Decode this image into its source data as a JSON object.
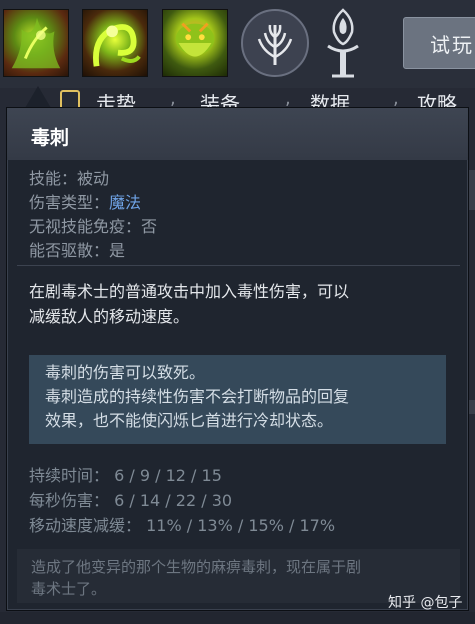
{
  "abilities": [
    {
      "name": "ability-1-icon",
      "colors": [
        "#b7e32a",
        "#5b2a10"
      ]
    },
    {
      "name": "ability-2-icon",
      "colors": [
        "#e8ff3a",
        "#4a2a0c"
      ]
    },
    {
      "name": "ability-3-icon",
      "colors": [
        "#ff9b3a",
        "#3f5a10"
      ]
    }
  ],
  "header": {
    "try_button": "试玩"
  },
  "tabs": [
    {
      "label": "走势"
    },
    {
      "label": "装备"
    },
    {
      "label": "数据"
    },
    {
      "label": "攻略"
    }
  ],
  "tooltip": {
    "title": "毒刺",
    "stats": [
      {
        "label": "技能：",
        "value": "被动"
      },
      {
        "label": "伤害类型：",
        "value": "魔法"
      },
      {
        "label": "无视技能免疫：",
        "value": "否"
      },
      {
        "label": "能否驱散：",
        "value": "是"
      }
    ],
    "description_lines": [
      "在剧毒术士的普通攻击中加入毒性伤害，可以",
      "减缓敌人的移动速度。"
    ],
    "note_lines": [
      "毒刺的伤害可以致死。",
      "毒刺造成的持续性伤害不会打断物品的回复",
      "效果，也不能使闪烁匕首进行冷却状态。"
    ],
    "attributes": [
      {
        "label": "持续时间：",
        "value": "6 / 9 / 12 / 15"
      },
      {
        "label": "每秒伤害：",
        "value": "6 / 14 / 22 / 30"
      },
      {
        "label": "移动速度减缓：",
        "value": "11% / 13% / 15% / 17%"
      }
    ],
    "lore_lines": [
      "造成了他变异的那个生物的麻痹毒刺，现在属于剧",
      "毒术士了。"
    ]
  },
  "watermark": "知乎 @包子",
  "colors": {
    "magic_damage": "#6fa3e6",
    "note_bg": "#35495a",
    "tooltip_bg": "#1f252f"
  }
}
